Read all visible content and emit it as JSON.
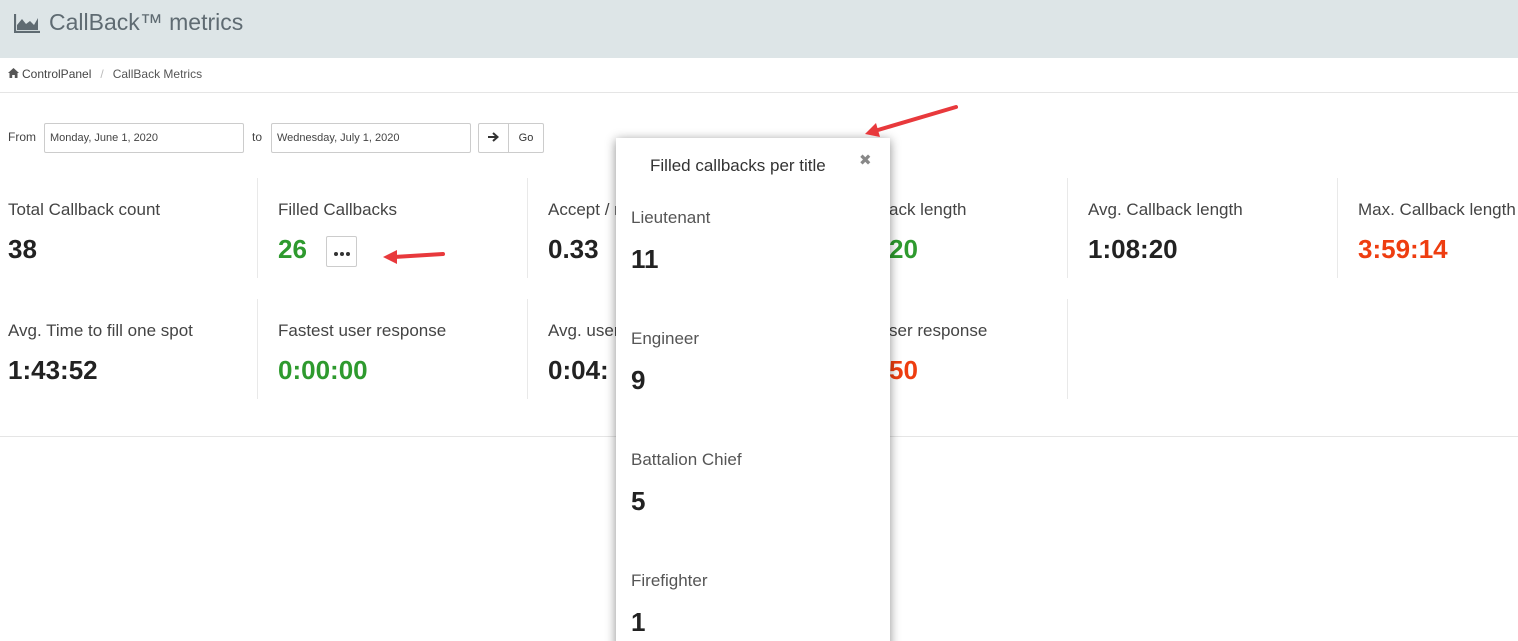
{
  "header": {
    "title": "CallBack™ metrics",
    "icon": "area-chart-icon"
  },
  "breadcrumb": {
    "home": "ControlPanel",
    "current": "CallBack Metrics"
  },
  "date_filter": {
    "from_label": "From",
    "from_value": "Monday, June 1, 2020",
    "to_label": "to",
    "to_value": "Wednesday, July 1, 2020",
    "go_label": "Go"
  },
  "metrics_row1": [
    {
      "label": "Total Callback count",
      "value": "38"
    },
    {
      "label": "Filled Callbacks",
      "value": "26"
    },
    {
      "label": "Accept / r",
      "value": "0.33"
    },
    {
      "label": "ack length",
      "value": "20"
    },
    {
      "label": "Avg. Callback length",
      "value": "1:08:20"
    },
    {
      "label": "Max. Callback length",
      "value": "3:59:14"
    }
  ],
  "metrics_row2": [
    {
      "label": "Avg. Time to fill one spot",
      "value": "1:43:52"
    },
    {
      "label": "Fastest user response",
      "value": "0:00:00"
    },
    {
      "label": "Avg. user",
      "value": "0:04:"
    },
    {
      "label": "ser response",
      "value": "50"
    }
  ],
  "popover": {
    "title": "Filled callbacks per title",
    "items": [
      {
        "label": "Lieutenant",
        "value": "11"
      },
      {
        "label": "Engineer",
        "value": "9"
      },
      {
        "label": "Battalion Chief",
        "value": "5"
      },
      {
        "label": "Firefighter",
        "value": "1"
      }
    ]
  },
  "colors": {
    "header_bg": "#dde5e7",
    "green": "#2e9a2e",
    "red": "#ee3d10",
    "annotation_arrow": "#e8393c"
  }
}
